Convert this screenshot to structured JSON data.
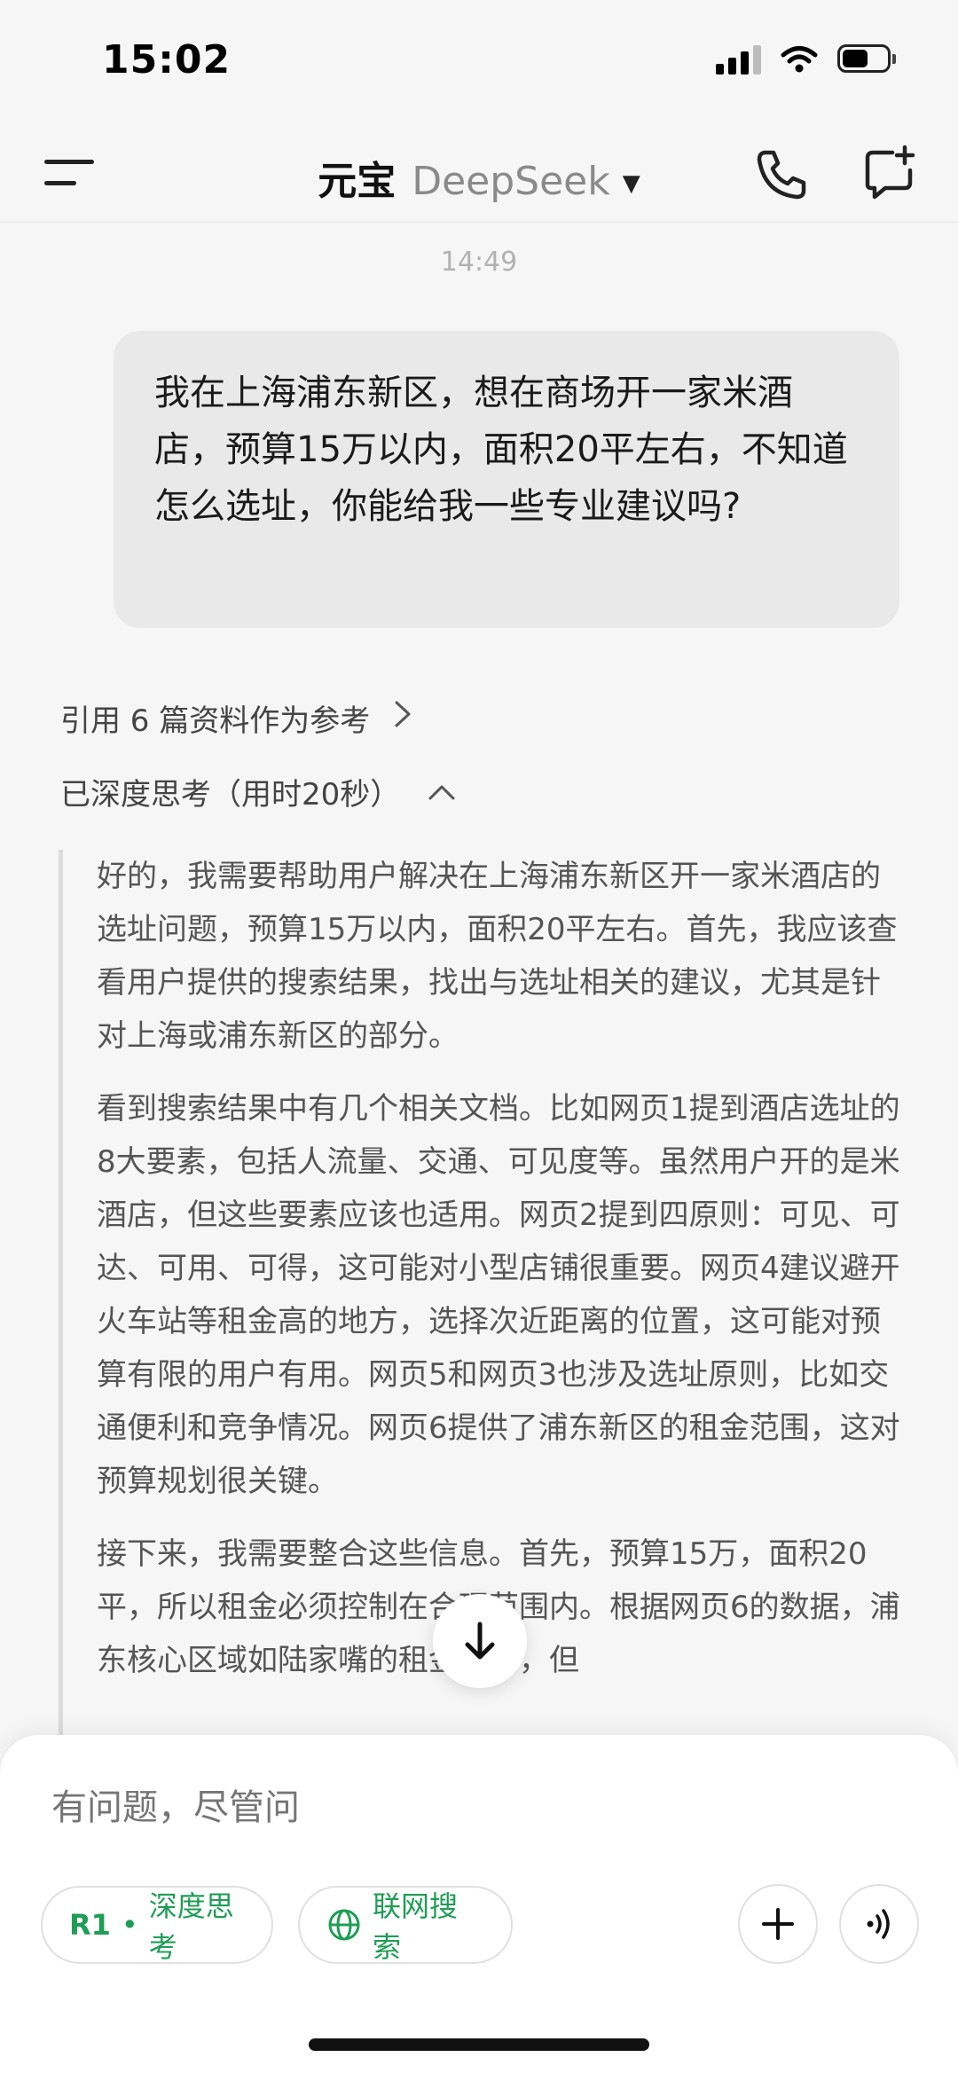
{
  "status_bar": {
    "time": "15:02",
    "battery_level": 0.6,
    "signal_bars": 3,
    "icons": [
      "signal-icon",
      "wifi-icon",
      "battery-icon"
    ]
  },
  "header": {
    "app_name": "元宝",
    "model_name": "DeepSeek",
    "icons": [
      "menu-icon",
      "caret-down-icon",
      "phone-icon",
      "new-chat-icon"
    ]
  },
  "chat": {
    "timestamp": "14:49",
    "user_message": "我在上海浦东新区，想在商场开一家米酒店，预算15万以内，面积20平左右，不知道怎么选址，你能给我一些专业建议吗?",
    "references_label": "引用 6 篇资料作为参考",
    "thinking_label": "已深度思考（用时20秒）",
    "thinking_paragraphs": [
      "好的，我需要帮助用户解决在上海浦东新区开一家米酒店的选址问题，预算15万以内，面积20平左右。首先，我应该查看用户提供的搜索结果，找出与选址相关的建议，尤其是针对上海或浦东新区的部分。",
      "看到搜索结果中有几个相关文档。比如网页1提到酒店选址的8大要素，包括人流量、交通、可见度等。虽然用户开的是米酒店，但这些要素应该也适用。网页2提到四原则：可见、可达、可用、可得，这可能对小型店铺很重要。网页4建议避开火车站等租金高的地方，选择次近距离的位置，这可能对预算有限的用户有用。网页5和网页3也涉及选址原则，比如交通便利和竞争情况。网页6提供了浦东新区的租金范围，这对预算规划很关键。",
      "接下来，我需要整合这些信息。首先，预算15万，面积20平，所以租金必须控制在合理范围内。根据网页6的数据，浦东核心区域如陆家嘴的租金较高，但"
    ]
  },
  "composer": {
    "placeholder": "有问题，尽管问",
    "chip_r1_badge": "R1",
    "chip_r1_dot": "•",
    "chip_r1_label": "深度思考",
    "chip_web_label": "联网搜索",
    "accent_color": "#1f9d55"
  }
}
